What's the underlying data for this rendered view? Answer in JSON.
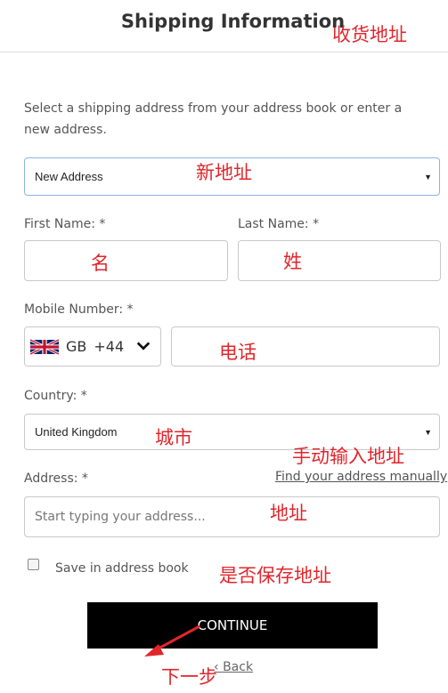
{
  "header": {
    "title": "Shipping Information"
  },
  "form": {
    "intro": "Select a shipping address from your address book or enter a new address.",
    "address_select": {
      "value": "New Address"
    },
    "first_name": {
      "label": "First Name: *",
      "value": ""
    },
    "last_name": {
      "label": "Last Name: *",
      "value": ""
    },
    "mobile": {
      "label": "Mobile Number: *",
      "country_code": "GB",
      "dial_code": "+44",
      "flag_icon": "uk-flag-icon",
      "value": ""
    },
    "country": {
      "label": "Country: *",
      "value": "United Kingdom"
    },
    "address": {
      "label": "Address: *",
      "manual_link": "Find your address manually",
      "placeholder": "Start typing your address..."
    },
    "save_checkbox": {
      "label": "Save in address book",
      "checked": false
    },
    "continue_label": "CONTINUE",
    "back_label": "Back"
  },
  "annotations": {
    "title_note": "收货地址",
    "address_select_note": "新地址",
    "first_name_note": "名",
    "last_name_note": "姓",
    "phone_note": "电话",
    "country_note": "城市",
    "manual_note": "手动输入地址",
    "address_note": "地址",
    "save_note": "是否保存地址",
    "continue_note": "下一步",
    "note_color": "#e0262b"
  }
}
